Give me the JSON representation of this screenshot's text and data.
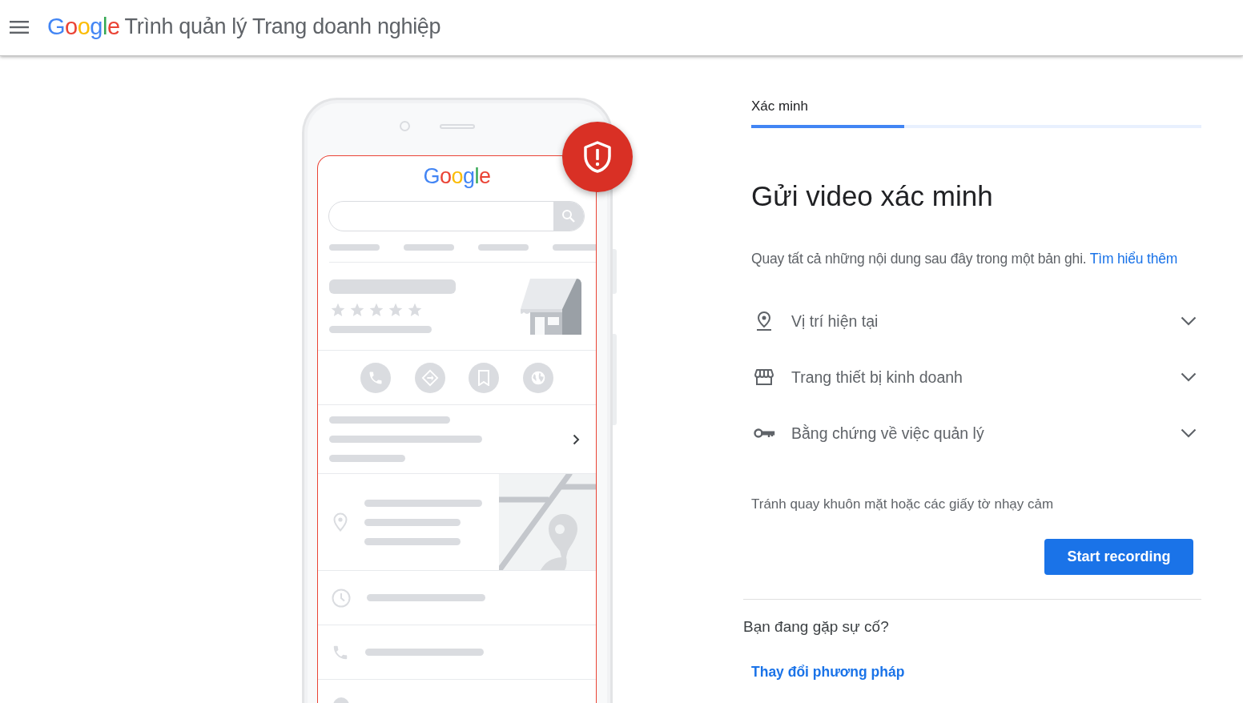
{
  "header": {
    "logo": "Google",
    "title": "Trình quản lý Trang doanh nghiệp"
  },
  "phone": {
    "logo": "Google"
  },
  "step": {
    "label": "Xác minh"
  },
  "progress": {
    "level": 0.34
  },
  "heading": "Gửi video xác minh",
  "instructions": {
    "text": "Quay tất cả những nội dung sau đây trong một bản ghi.",
    "link": "Tìm hiểu thêm"
  },
  "checklist": [
    {
      "kind": "pin",
      "label": "Vị trí hiện tại",
      "expanded": false
    },
    {
      "kind": "store",
      "label": "Trang thiết bị kinh doanh",
      "expanded": false
    },
    {
      "kind": "key",
      "label": "Bằng chứng về việc quản lý",
      "expanded": false
    }
  ],
  "note": "Tránh quay khuôn mặt hoặc các giấy tờ nhạy cảm",
  "primary_button": "Start recording",
  "help": {
    "heading": "Bạn đang gặp sự cố?",
    "link": "Thay đổi phương pháp"
  }
}
